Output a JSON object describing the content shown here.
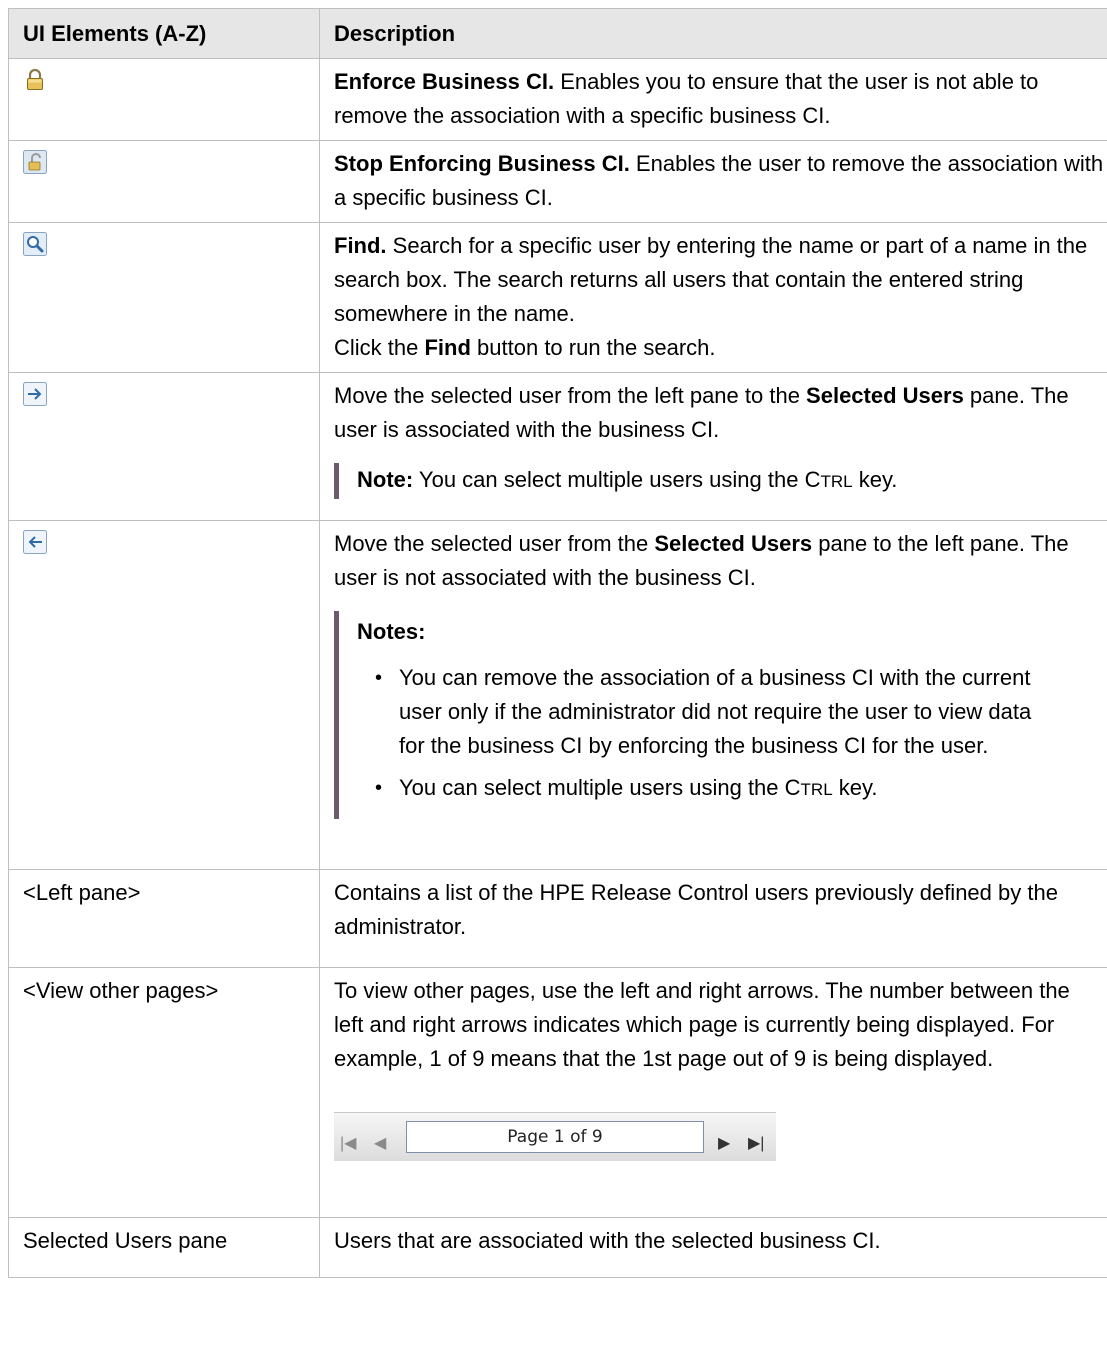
{
  "header": {
    "col1": "UI Elements (A-Z)",
    "col2": "Description"
  },
  "rows": {
    "enforce": {
      "icon": "lock-icon",
      "title": "Enforce Business CI.",
      "text": " Enables you to ensure that the user is not able to remove the association with a specific business CI."
    },
    "stop": {
      "icon": "unlock-icon",
      "title": "Stop Enforcing Business CI.",
      "text": " Enables the user to remove the association with a specific business CI."
    },
    "find": {
      "icon": "magnifier-icon",
      "title": "Find.",
      "text": " Search for a specific user by entering the name or part of a name in the search box. The search returns all users that contain the entered string somewhere in the name.",
      "line2_pre": "Click the ",
      "line2_bold": "Find",
      "line2_post": " button to run the search."
    },
    "move_right": {
      "icon": "arrow-right-icon",
      "pre": "Move the selected user from the left pane to the ",
      "bold": "Selected Users",
      "post": " pane. The user is associated with the business CI.",
      "note_label": "Note:",
      "note_pre": " You can select multiple users using the C",
      "note_sc": "TRL",
      "note_post": " key."
    },
    "move_left": {
      "icon": "arrow-left-icon",
      "pre": "Move the selected user from the ",
      "bold": "Selected Users",
      "post": " pane to the left pane. The user is not associated with the business CI.",
      "notes_title": "Notes:",
      "bullet1": "You can remove the association of a business CI with the current user only if the administrator did not require the user to view data for the business CI by enforcing the business CI for the user.",
      "bullet2_pre": "You can select multiple users using the C",
      "bullet2_sc": "TRL",
      "bullet2_post": " key."
    },
    "left_pane": {
      "name": "<Left pane>",
      "text": "Contains a list of the HPE Release Control users previously defined by the administrator."
    },
    "view_pages": {
      "name": "<View other pages>",
      "text": "To view other pages, use the left and right arrows. The number between the left and right arrows indicates which page is currently being displayed. For example, 1 of 9 means that the 1st page out of 9 is being displayed.",
      "pager_label": "Page 1 of 9"
    },
    "selected_pane": {
      "name": "Selected Users pane",
      "text": "Users that are associated with the selected business CI."
    }
  }
}
